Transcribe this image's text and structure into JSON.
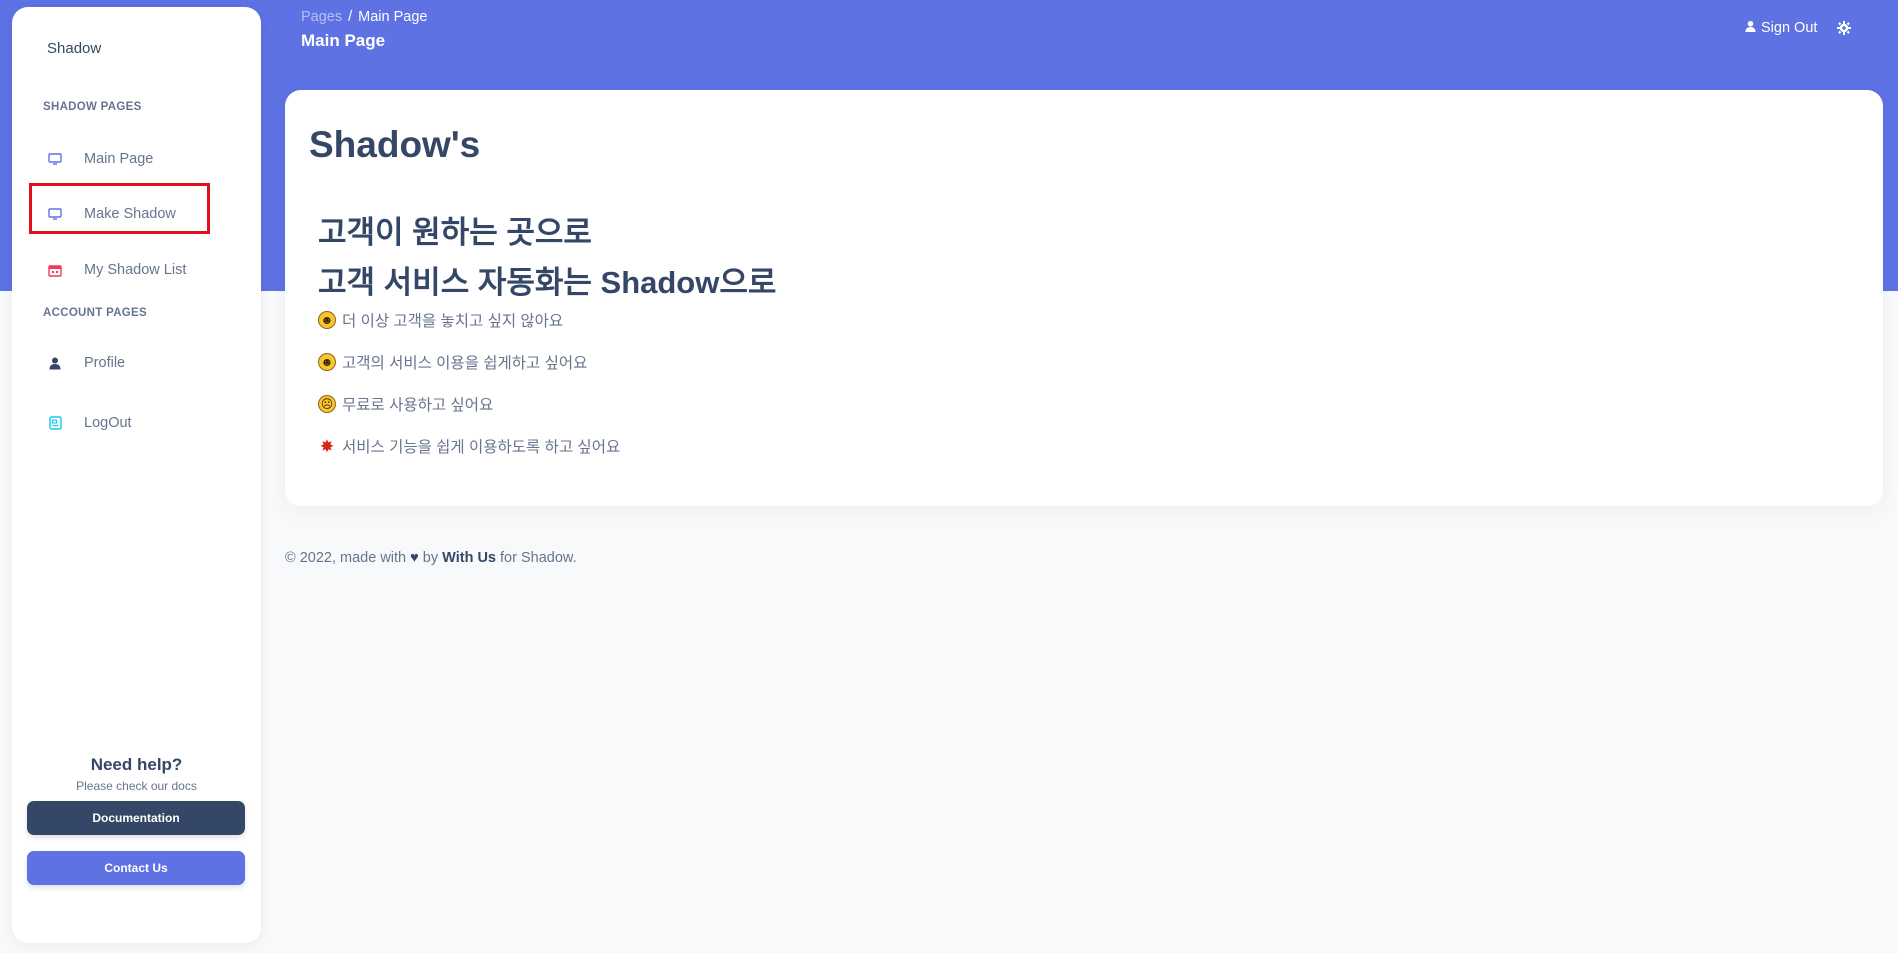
{
  "sidebar": {
    "brand": "Shadow",
    "section_shadow": "SHADOW PAGES",
    "section_account": "ACCOUNT PAGES",
    "items": [
      {
        "label": "Main Page",
        "icon": "monitor-icon"
      },
      {
        "label": "Make Shadow",
        "icon": "monitor-icon"
      },
      {
        "label": "My Shadow List",
        "icon": "calendar-icon"
      },
      {
        "label": "Profile",
        "icon": "user-icon"
      },
      {
        "label": "LogOut",
        "icon": "receipt-icon"
      }
    ],
    "help": {
      "title": "Need help?",
      "subtitle": "Please check our docs",
      "documentation_label": "Documentation",
      "contact_label": "Contact Us"
    }
  },
  "header": {
    "breadcrumb_parent": "Pages",
    "breadcrumb_sep": "/",
    "breadcrumb_current": "Main Page",
    "title": "Main Page",
    "signout_label": "Sign Out"
  },
  "main": {
    "title": "Shadow's",
    "headline_1": "고객이 원하는 곳으로",
    "headline_2": "고객 서비스 자동화는 Shadow으로",
    "bullets": [
      {
        "emoji": "grinning-face",
        "text": "더 이상 고객을 놓치고 싶지 않아요"
      },
      {
        "emoji": "laughing-face",
        "text": "고객의 서비스 이용을 쉽게하고 싶어요"
      },
      {
        "emoji": "persevering-face",
        "text": "무료로 사용하고 싶어요"
      },
      {
        "emoji": "collision",
        "text": "서비스 기능을 쉽게 이용하도록 하고 싶어요"
      }
    ]
  },
  "footer": {
    "prefix": "© 2022, made with",
    "by": "by",
    "author": "With Us",
    "suffix": "for Shadow."
  },
  "colors": {
    "primary": "#5e72e4",
    "dark": "#344767",
    "muted": "#67748e",
    "highlight": "#e0101a",
    "calendar_icon": "#f5365c",
    "receipt_icon": "#11cdef"
  }
}
